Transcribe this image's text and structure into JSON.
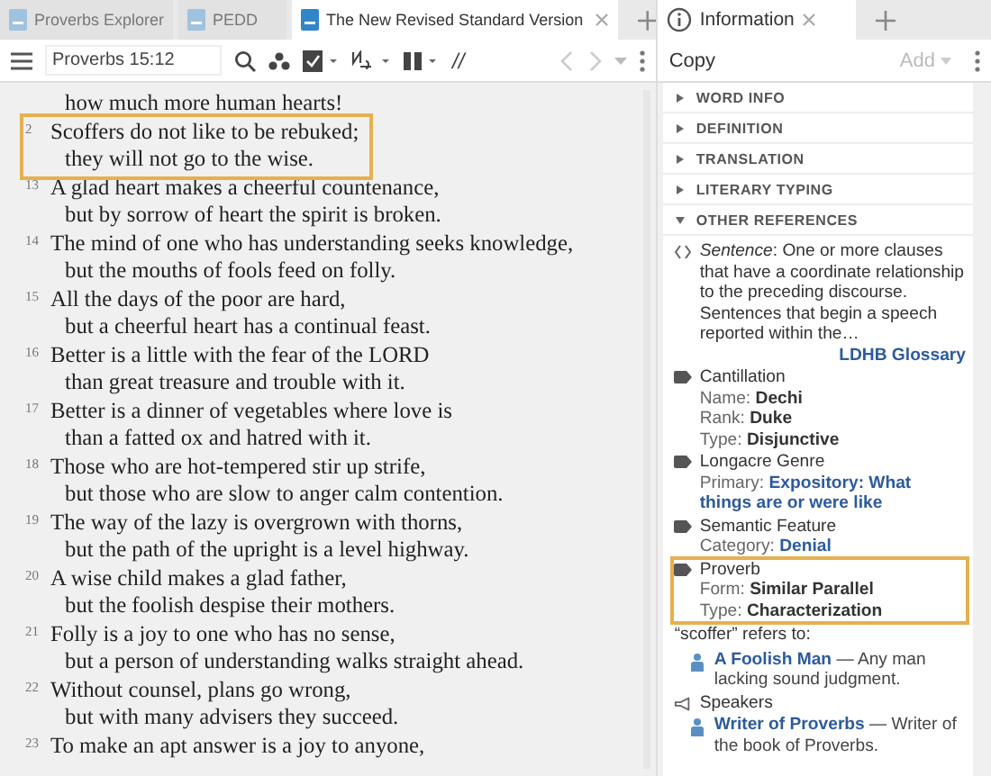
{
  "tabs": [
    {
      "label": "Proverbs Explorer",
      "selected": false
    },
    {
      "label": "PEDD",
      "selected": false
    },
    {
      "label": "The New Revised Standard Version",
      "selected": true
    }
  ],
  "toolbar": {
    "reference": "Proverbs 15:12",
    "parallel_label": "//"
  },
  "verses": [
    {
      "lines": [
        "how much more human hearts!"
      ],
      "highlighted": false
    },
    {
      "number": "2",
      "lines": [
        "Scoffers do not like to be rebuked;",
        "they will not go to the wise."
      ],
      "highlighted": true
    },
    {
      "number": "13",
      "lines": [
        "A glad heart makes a cheerful countenance,",
        "but by sorrow of heart the spirit is broken."
      ],
      "highlighted": false
    },
    {
      "number": "14",
      "lines": [
        "The mind of one who has understanding seeks knowledge,",
        "but the mouths of fools feed on folly."
      ],
      "highlighted": false
    },
    {
      "number": "15",
      "lines": [
        "All the days of the poor are hard,",
        "but a cheerful heart has a continual feast."
      ],
      "highlighted": false
    },
    {
      "number": "16",
      "lines": [
        "Better is a little with the fear of the LORD",
        "than great treasure and trouble with it."
      ],
      "highlighted": false
    },
    {
      "number": "17",
      "lines": [
        "Better is a dinner of vegetables where love is",
        "than a fatted ox and hatred with it."
      ],
      "highlighted": false
    },
    {
      "number": "18",
      "lines": [
        "Those who are hot-tempered stir up strife,",
        "but those who are slow to anger calm contention."
      ],
      "highlighted": false
    },
    {
      "number": "19",
      "lines": [
        "The way of the lazy is overgrown with thorns,",
        "but the path of the upright is a level highway."
      ],
      "highlighted": false
    },
    {
      "number": "20",
      "lines": [
        "A wise child makes a glad father,",
        "but the foolish despise their mothers."
      ],
      "highlighted": false
    },
    {
      "number": "21",
      "lines": [
        "Folly is a joy to one who has no sense,",
        "but a person of understanding walks straight ahead."
      ],
      "highlighted": false
    },
    {
      "number": "22",
      "lines": [
        "Without counsel, plans go wrong,",
        "but with many advisers they succeed."
      ],
      "highlighted": false
    },
    {
      "number": "23",
      "lines": [
        "To make an apt answer is a joy to anyone,"
      ],
      "highlighted": false
    }
  ],
  "info": {
    "tab": {
      "label": "Information",
      "selected": true
    },
    "copy": "Copy",
    "add": "Add",
    "sections": [
      {
        "label": "WORD INFO",
        "expanded": false
      },
      {
        "label": "DEFINITION",
        "expanded": false
      },
      {
        "label": "TRANSLATION",
        "expanded": false
      },
      {
        "label": "LITERARY TYPING",
        "expanded": false
      },
      {
        "label": "OTHER REFERENCES",
        "expanded": true
      }
    ],
    "entries": [
      {
        "kind": "definition",
        "text": "*Sentence*: One or more clauses that have a coordinate relationship to the preceding discourse. Sentences that begin a speech reported within the…",
        "link": "LDHB Glossary"
      },
      {
        "kind": "tag",
        "title": "Cantillation",
        "highlighted": false,
        "fields": [
          {
            "label": "Name:",
            "value": "Dechi",
            "link": false
          },
          {
            "label": "Rank:",
            "value": "Duke",
            "link": false
          },
          {
            "label": "Type:",
            "value": "Disjunctive",
            "link": false
          }
        ]
      },
      {
        "kind": "tag",
        "title": "Longacre Genre",
        "highlighted": false,
        "fields": [
          {
            "label": "Primary:",
            "value": "Expository: What things are or were like",
            "link": true
          }
        ]
      },
      {
        "kind": "tag",
        "title": "Semantic Feature",
        "highlighted": false,
        "fields": [
          {
            "label": "Category:",
            "value": "Denial",
            "link": true
          }
        ]
      },
      {
        "kind": "tag",
        "title": "Proverb",
        "highlighted": true,
        "fields": [
          {
            "label": "Form:",
            "value": "Similar Parallel",
            "link": false
          },
          {
            "label": "Type:",
            "value": "Characterization",
            "link": false
          }
        ]
      },
      {
        "kind": "heading",
        "text": "“scoffer” refers to:"
      },
      {
        "kind": "person",
        "name": "A Foolish Man",
        "text": "— Any man lacking sound judgment."
      },
      {
        "kind": "speakers",
        "text": "Speakers"
      },
      {
        "kind": "person",
        "name": "Writer of Proverbs",
        "text": "— Writer of the book of Proverbs."
      }
    ]
  }
}
